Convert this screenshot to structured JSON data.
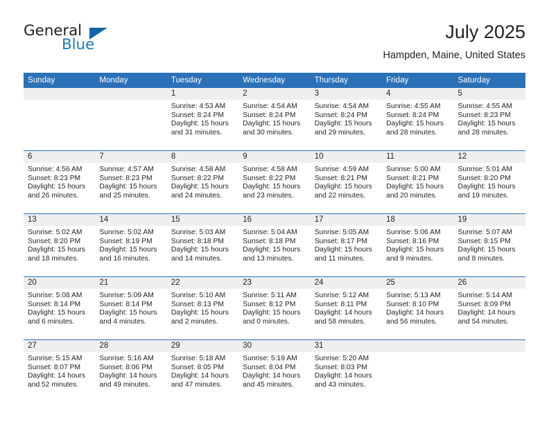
{
  "brand": {
    "name_part1": "General",
    "name_part2": "Blue",
    "triangle_icon": "triangle-icon",
    "colors": {
      "dark": "#231f20",
      "blue": "#1a7cc4",
      "triangle": "#1565a8"
    }
  },
  "header": {
    "month_title": "July 2025",
    "location": "Hampden, Maine, United States"
  },
  "calendar": {
    "accent_color": "#2b71b8",
    "daynum_band_color": "#efefef",
    "weekday_headers": [
      "Sunday",
      "Monday",
      "Tuesday",
      "Wednesday",
      "Thursday",
      "Friday",
      "Saturday"
    ],
    "weeks": [
      [
        {
          "day": "",
          "empty": true
        },
        {
          "day": "",
          "empty": true
        },
        {
          "day": "1",
          "sunrise": "Sunrise: 4:53 AM",
          "sunset": "Sunset: 8:24 PM",
          "daylight": "Daylight: 15 hours and 31 minutes."
        },
        {
          "day": "2",
          "sunrise": "Sunrise: 4:54 AM",
          "sunset": "Sunset: 8:24 PM",
          "daylight": "Daylight: 15 hours and 30 minutes."
        },
        {
          "day": "3",
          "sunrise": "Sunrise: 4:54 AM",
          "sunset": "Sunset: 8:24 PM",
          "daylight": "Daylight: 15 hours and 29 minutes."
        },
        {
          "day": "4",
          "sunrise": "Sunrise: 4:55 AM",
          "sunset": "Sunset: 8:24 PM",
          "daylight": "Daylight: 15 hours and 28 minutes."
        },
        {
          "day": "5",
          "sunrise": "Sunrise: 4:55 AM",
          "sunset": "Sunset: 8:23 PM",
          "daylight": "Daylight: 15 hours and 28 minutes."
        }
      ],
      [
        {
          "day": "6",
          "sunrise": "Sunrise: 4:56 AM",
          "sunset": "Sunset: 8:23 PM",
          "daylight": "Daylight: 15 hours and 26 minutes."
        },
        {
          "day": "7",
          "sunrise": "Sunrise: 4:57 AM",
          "sunset": "Sunset: 8:23 PM",
          "daylight": "Daylight: 15 hours and 25 minutes."
        },
        {
          "day": "8",
          "sunrise": "Sunrise: 4:58 AM",
          "sunset": "Sunset: 8:22 PM",
          "daylight": "Daylight: 15 hours and 24 minutes."
        },
        {
          "day": "9",
          "sunrise": "Sunrise: 4:58 AM",
          "sunset": "Sunset: 8:22 PM",
          "daylight": "Daylight: 15 hours and 23 minutes."
        },
        {
          "day": "10",
          "sunrise": "Sunrise: 4:59 AM",
          "sunset": "Sunset: 8:21 PM",
          "daylight": "Daylight: 15 hours and 22 minutes."
        },
        {
          "day": "11",
          "sunrise": "Sunrise: 5:00 AM",
          "sunset": "Sunset: 8:21 PM",
          "daylight": "Daylight: 15 hours and 20 minutes."
        },
        {
          "day": "12",
          "sunrise": "Sunrise: 5:01 AM",
          "sunset": "Sunset: 8:20 PM",
          "daylight": "Daylight: 15 hours and 19 minutes."
        }
      ],
      [
        {
          "day": "13",
          "sunrise": "Sunrise: 5:02 AM",
          "sunset": "Sunset: 8:20 PM",
          "daylight": "Daylight: 15 hours and 18 minutes."
        },
        {
          "day": "14",
          "sunrise": "Sunrise: 5:02 AM",
          "sunset": "Sunset: 8:19 PM",
          "daylight": "Daylight: 15 hours and 16 minutes."
        },
        {
          "day": "15",
          "sunrise": "Sunrise: 5:03 AM",
          "sunset": "Sunset: 8:18 PM",
          "daylight": "Daylight: 15 hours and 14 minutes."
        },
        {
          "day": "16",
          "sunrise": "Sunrise: 5:04 AM",
          "sunset": "Sunset: 8:18 PM",
          "daylight": "Daylight: 15 hours and 13 minutes."
        },
        {
          "day": "17",
          "sunrise": "Sunrise: 5:05 AM",
          "sunset": "Sunset: 8:17 PM",
          "daylight": "Daylight: 15 hours and 11 minutes."
        },
        {
          "day": "18",
          "sunrise": "Sunrise: 5:06 AM",
          "sunset": "Sunset: 8:16 PM",
          "daylight": "Daylight: 15 hours and 9 minutes."
        },
        {
          "day": "19",
          "sunrise": "Sunrise: 5:07 AM",
          "sunset": "Sunset: 8:15 PM",
          "daylight": "Daylight: 15 hours and 8 minutes."
        }
      ],
      [
        {
          "day": "20",
          "sunrise": "Sunrise: 5:08 AM",
          "sunset": "Sunset: 8:14 PM",
          "daylight": "Daylight: 15 hours and 6 minutes."
        },
        {
          "day": "21",
          "sunrise": "Sunrise: 5:09 AM",
          "sunset": "Sunset: 8:14 PM",
          "daylight": "Daylight: 15 hours and 4 minutes."
        },
        {
          "day": "22",
          "sunrise": "Sunrise: 5:10 AM",
          "sunset": "Sunset: 8:13 PM",
          "daylight": "Daylight: 15 hours and 2 minutes."
        },
        {
          "day": "23",
          "sunrise": "Sunrise: 5:11 AM",
          "sunset": "Sunset: 8:12 PM",
          "daylight": "Daylight: 15 hours and 0 minutes."
        },
        {
          "day": "24",
          "sunrise": "Sunrise: 5:12 AM",
          "sunset": "Sunset: 8:11 PM",
          "daylight": "Daylight: 14 hours and 58 minutes."
        },
        {
          "day": "25",
          "sunrise": "Sunrise: 5:13 AM",
          "sunset": "Sunset: 8:10 PM",
          "daylight": "Daylight: 14 hours and 56 minutes."
        },
        {
          "day": "26",
          "sunrise": "Sunrise: 5:14 AM",
          "sunset": "Sunset: 8:09 PM",
          "daylight": "Daylight: 14 hours and 54 minutes."
        }
      ],
      [
        {
          "day": "27",
          "sunrise": "Sunrise: 5:15 AM",
          "sunset": "Sunset: 8:07 PM",
          "daylight": "Daylight: 14 hours and 52 minutes."
        },
        {
          "day": "28",
          "sunrise": "Sunrise: 5:16 AM",
          "sunset": "Sunset: 8:06 PM",
          "daylight": "Daylight: 14 hours and 49 minutes."
        },
        {
          "day": "29",
          "sunrise": "Sunrise: 5:18 AM",
          "sunset": "Sunset: 8:05 PM",
          "daylight": "Daylight: 14 hours and 47 minutes."
        },
        {
          "day": "30",
          "sunrise": "Sunrise: 5:19 AM",
          "sunset": "Sunset: 8:04 PM",
          "daylight": "Daylight: 14 hours and 45 minutes."
        },
        {
          "day": "31",
          "sunrise": "Sunrise: 5:20 AM",
          "sunset": "Sunset: 8:03 PM",
          "daylight": "Daylight: 14 hours and 43 minutes."
        },
        {
          "day": "",
          "empty": true
        },
        {
          "day": "",
          "empty": true
        }
      ]
    ]
  }
}
